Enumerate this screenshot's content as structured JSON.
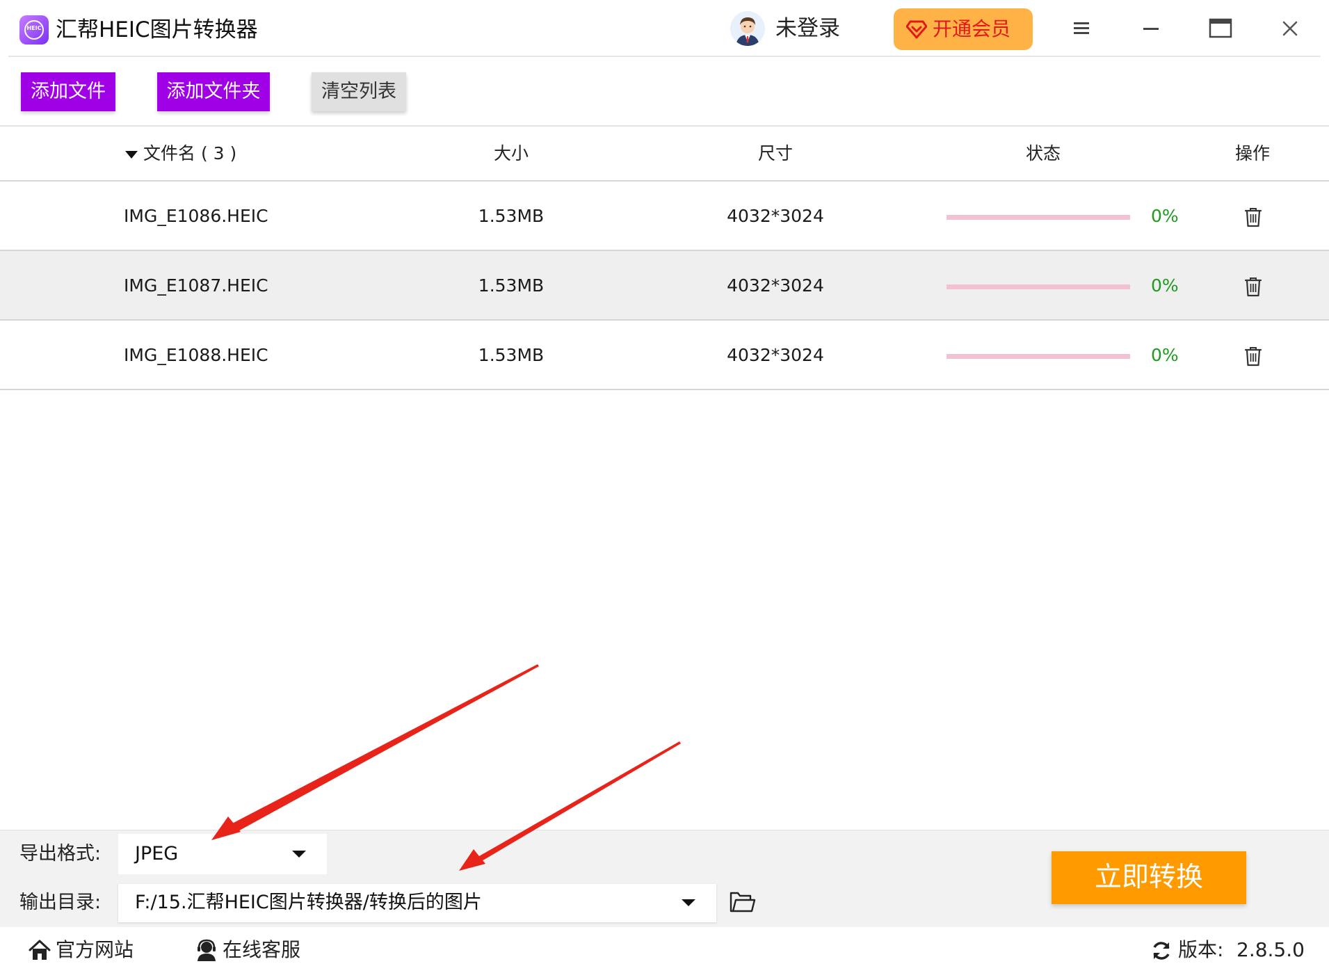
{
  "app": {
    "title": "汇帮HEIC图片转换器",
    "logo_text": "HEIC",
    "user": {
      "login_status": "未登录"
    },
    "vip_button": "开通会员"
  },
  "toolbar": {
    "add_file": "添加文件",
    "add_folder": "添加文件夹",
    "clear_list": "清空列表"
  },
  "table": {
    "header": {
      "name": "文件名 ( 3 )",
      "size": "大小",
      "dimension": "尺寸",
      "status": "状态",
      "operation": "操作"
    },
    "rows": [
      {
        "name": "IMG_E1086.HEIC",
        "size": "1.53MB",
        "dimension": "4032*3024",
        "progress": 0,
        "percent": "0%"
      },
      {
        "name": "IMG_E1087.HEIC",
        "size": "1.53MB",
        "dimension": "4032*3024",
        "progress": 0,
        "percent": "0%"
      },
      {
        "name": "IMG_E1088.HEIC",
        "size": "1.53MB",
        "dimension": "4032*3024",
        "progress": 0,
        "percent": "0%"
      }
    ]
  },
  "settings": {
    "format_label": "导出格式:",
    "format_value": "JPEG",
    "output_label": "输出目录:",
    "output_value": "F:/15.汇帮HEIC图片转换器/转换后的图片"
  },
  "convert_button": "立即转换",
  "footer": {
    "website": "官方网站",
    "support": "在线客服",
    "version_label": "版本:",
    "version_value": "2.8.5.0"
  },
  "colors": {
    "primary_purple": "#a000e6",
    "convert_orange": "#ff9b00",
    "vip_orange": "#ffb347",
    "percent_green": "#1c9b1c",
    "annotation_red": "#e8231a"
  }
}
